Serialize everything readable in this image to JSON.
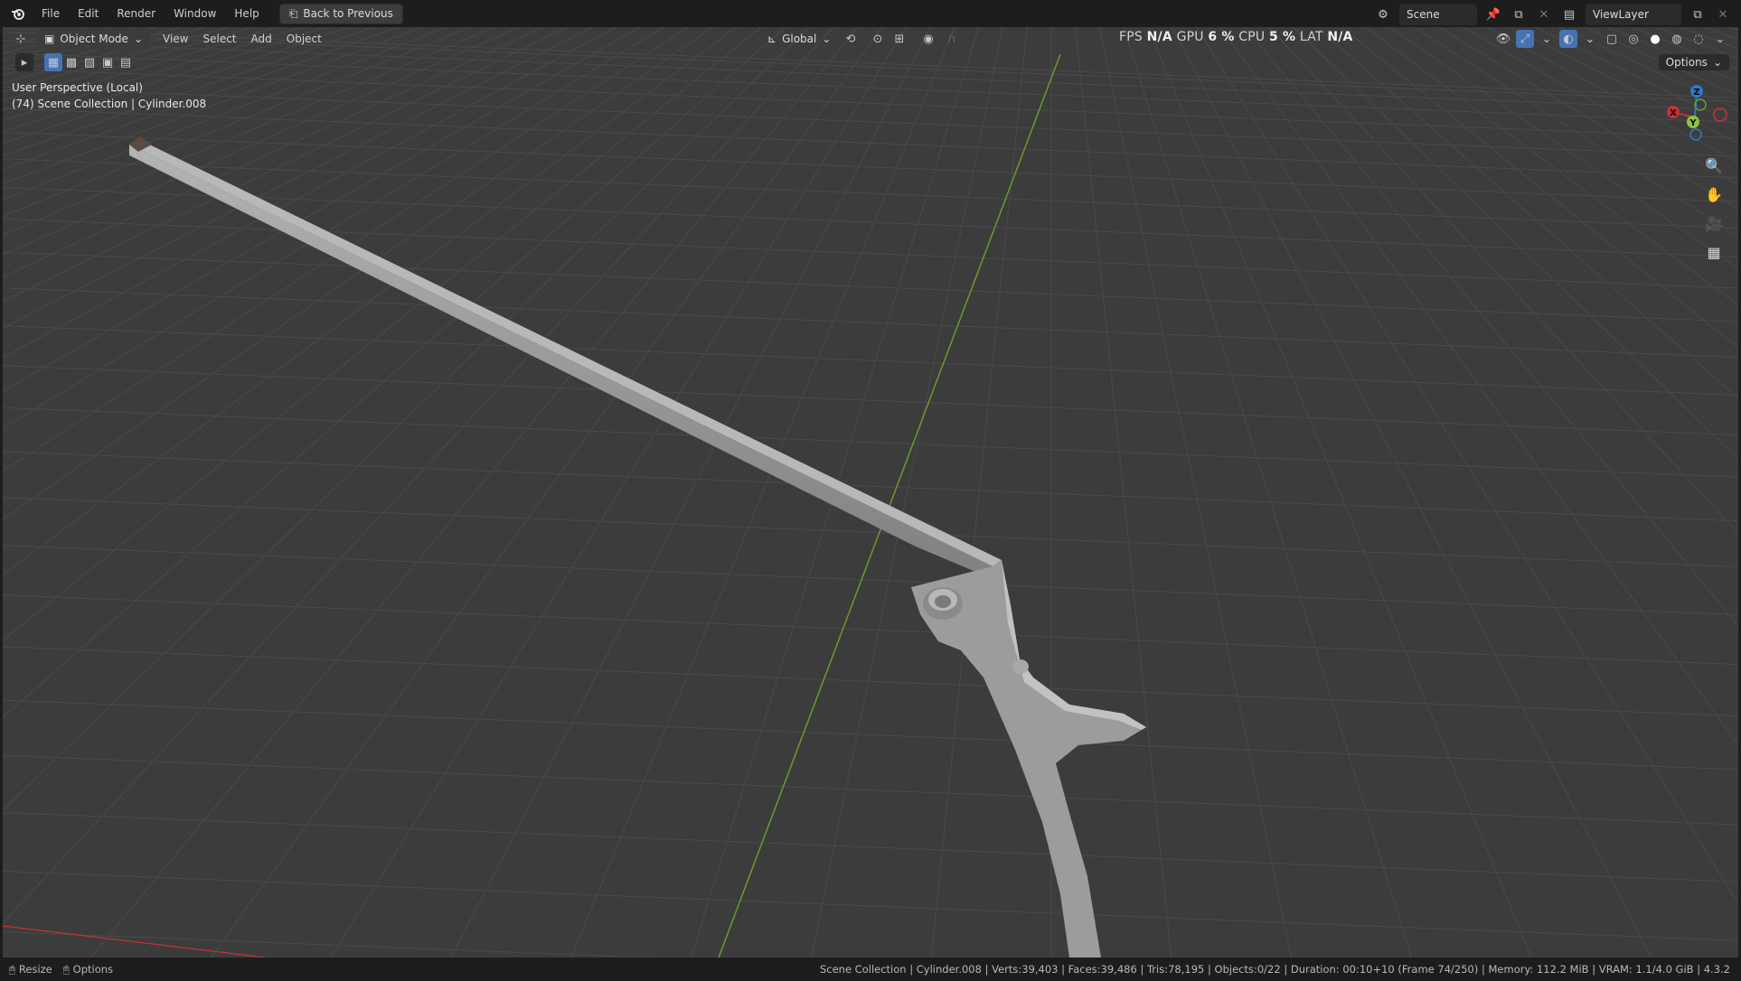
{
  "menu": {
    "items": [
      "File",
      "Edit",
      "Render",
      "Window",
      "Help"
    ],
    "back_button": "Back to Previous"
  },
  "topright": {
    "scene": "Scene",
    "view_layer": "ViewLayer"
  },
  "viewport_header": {
    "mode": "Object Mode",
    "menus": [
      "View",
      "Select",
      "Add",
      "Object"
    ],
    "orientation": "Global",
    "options": "Options"
  },
  "stats_overlay": {
    "fps_label": "FPS",
    "fps_value": "N/A",
    "gpu_label": "GPU",
    "gpu_value": "6 %",
    "cpu_label": "CPU",
    "cpu_value": "5 %",
    "lat_label": "LAT",
    "lat_value": "N/A"
  },
  "viewport": {
    "perspective": "User Perspective (Local)",
    "collection": "(74) Scene Collection | Cylinder.008"
  },
  "gizmo": {
    "z": "Z",
    "y": "Y",
    "x": "X"
  },
  "icons": [
    "blender-logo-icon",
    "zoom-icon",
    "hand-pan-icon",
    "camera-icon",
    "grid-icon"
  ],
  "colors": {
    "viewport_bg": "#3c3c3c",
    "axis_x": "#c8303a",
    "axis_y": "#6a9a2e",
    "axis_z": "#2f78c8",
    "object": "#9a9a9a"
  },
  "statusbar": {
    "resize": "Resize",
    "options": "Options",
    "info": "Scene Collection | Cylinder.008 | Verts:39,403 | Faces:39,486 | Tris:78,195 | Objects:0/22 | Duration: 00:10+10 (Frame 74/250) | Memory: 112.2 MiB | VRAM: 1.1/4.0 GiB | 4.3.2"
  }
}
